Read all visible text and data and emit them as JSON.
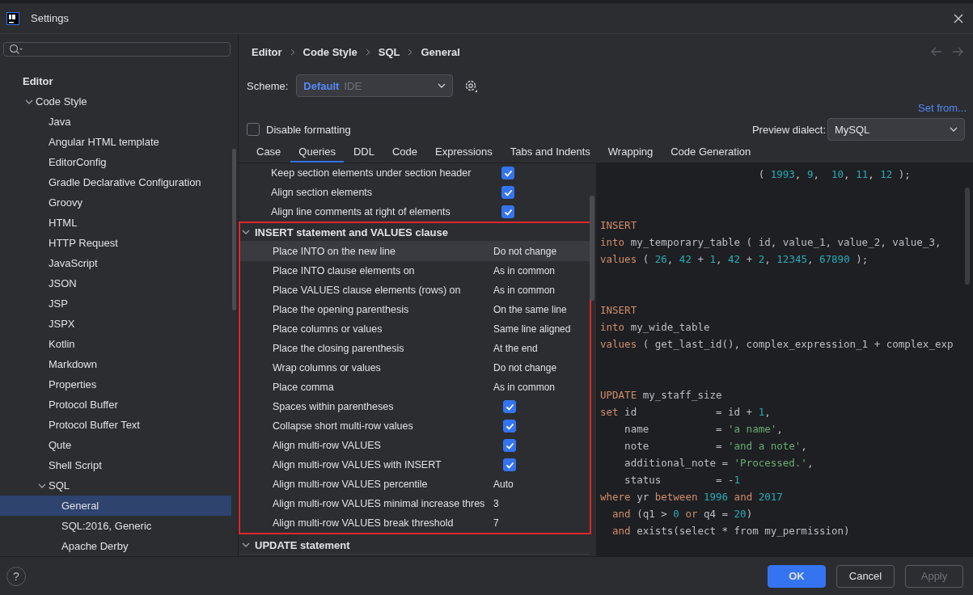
{
  "window": {
    "title": "Settings"
  },
  "sidebar": {
    "tree": [
      {
        "label": "Editor",
        "kind": "group",
        "selected": false,
        "children": [
          {
            "label": "Code Style",
            "kind": "node",
            "selected": false,
            "expanded": true,
            "children": [
              {
                "label": "Java",
                "kind": "node",
                "selected": false
              },
              {
                "label": "Angular HTML template",
                "kind": "node",
                "selected": false
              },
              {
                "label": "EditorConfig",
                "kind": "node",
                "selected": false
              },
              {
                "label": "Gradle Declarative Configuration",
                "kind": "node",
                "selected": false
              },
              {
                "label": "Groovy",
                "kind": "node",
                "selected": false
              },
              {
                "label": "HTML",
                "kind": "node",
                "selected": false
              },
              {
                "label": "HTTP Request",
                "kind": "node",
                "selected": false
              },
              {
                "label": "JavaScript",
                "kind": "node",
                "selected": false
              },
              {
                "label": "JSON",
                "kind": "node",
                "selected": false
              },
              {
                "label": "JSP",
                "kind": "node",
                "selected": false
              },
              {
                "label": "JSPX",
                "kind": "node",
                "selected": false
              },
              {
                "label": "Kotlin",
                "kind": "node",
                "selected": false
              },
              {
                "label": "Markdown",
                "kind": "node",
                "selected": false
              },
              {
                "label": "Properties",
                "kind": "node",
                "selected": false
              },
              {
                "label": "Protocol Buffer",
                "kind": "node",
                "selected": false
              },
              {
                "label": "Protocol Buffer Text",
                "kind": "node",
                "selected": false
              },
              {
                "label": "Qute",
                "kind": "node",
                "selected": false
              },
              {
                "label": "Shell Script",
                "kind": "node",
                "selected": false
              },
              {
                "label": "SQL",
                "kind": "node",
                "selected": false,
                "expanded": true,
                "children": [
                  {
                    "label": "General",
                    "kind": "node",
                    "selected": true
                  },
                  {
                    "label": "SQL:2016, Generic",
                    "kind": "node",
                    "selected": false
                  },
                  {
                    "label": "Apache Derby",
                    "kind": "node",
                    "selected": false
                  }
                ]
              }
            ]
          }
        ]
      }
    ]
  },
  "help": "?",
  "breadcrumb": [
    "Editor",
    "Code Style",
    "SQL",
    "General"
  ],
  "scheme": {
    "label": "Scheme:",
    "name": "Default",
    "tag": "IDE"
  },
  "set_from": "Set from...",
  "disable_formatting": {
    "label": "Disable formatting",
    "checked": false
  },
  "preview_dialect": {
    "label": "Preview dialect:",
    "value": "MySQL"
  },
  "tabs": [
    {
      "label": "Case",
      "selected": false
    },
    {
      "label": "Queries",
      "selected": true
    },
    {
      "label": "DDL",
      "selected": false
    },
    {
      "label": "Code",
      "selected": false
    },
    {
      "label": "Expressions",
      "selected": false
    },
    {
      "label": "Tabs and Indents",
      "selected": false
    },
    {
      "label": "Wrapping",
      "selected": false
    },
    {
      "label": "Code Generation",
      "selected": false
    }
  ],
  "options": {
    "leading_rows": [
      {
        "kind": "checkbox",
        "label": "Keep section elements under section header",
        "checked": true,
        "selected": false
      },
      {
        "kind": "checkbox",
        "label": "Align section elements",
        "checked": true,
        "selected": false
      },
      {
        "kind": "checkbox",
        "label": "Align line comments at right of elements",
        "checked": true,
        "selected": false
      }
    ],
    "sections": [
      {
        "title": "INSERT statement and VALUES clause",
        "expanded": true,
        "highlighted": true,
        "rows": [
          {
            "kind": "value",
            "label": "Place INTO on the new line",
            "value": "Do not change",
            "selected": true
          },
          {
            "kind": "value",
            "label": "Place INTO clause elements on",
            "value": "As in common",
            "selected": false
          },
          {
            "kind": "value",
            "label": "Place VALUES clause elements (rows) on",
            "value": "As in common",
            "selected": false
          },
          {
            "kind": "value",
            "label": "Place the opening parenthesis",
            "value": "On the same line",
            "selected": false
          },
          {
            "kind": "value",
            "label": "Place columns or values",
            "value": "Same line aligned",
            "selected": false
          },
          {
            "kind": "value",
            "label": "Place the closing parenthesis",
            "value": "At the end",
            "selected": false
          },
          {
            "kind": "value",
            "label": "Wrap columns or values",
            "value": "Do not change",
            "selected": false
          },
          {
            "kind": "value",
            "label": "Place comma",
            "value": "As in common",
            "selected": false
          },
          {
            "kind": "checkbox",
            "label": "Spaces within parentheses",
            "checked": true,
            "selected": false
          },
          {
            "kind": "checkbox",
            "label": "Collapse short multi-row values",
            "checked": true,
            "selected": false
          },
          {
            "kind": "checkbox",
            "label": "Align multi-row VALUES",
            "checked": true,
            "selected": false
          },
          {
            "kind": "checkbox",
            "label": "Align multi-row VALUES with INSERT",
            "checked": true,
            "selected": false
          },
          {
            "kind": "value",
            "label": "Align multi-row VALUES percentile",
            "value": "Auto",
            "selected": false
          },
          {
            "kind": "value",
            "label": "Align multi-row VALUES minimal increase thres",
            "value": "3",
            "selected": false
          },
          {
            "kind": "value",
            "label": "Align multi-row VALUES break threshold",
            "value": "7",
            "selected": false
          }
        ]
      },
      {
        "title": "UPDATE statement",
        "expanded": true,
        "highlighted": false
      }
    ]
  },
  "preview": {
    "blocks": [
      [
        [
          {
            "kind": "punct",
            "text": "                          ( "
          },
          {
            "kind": "number",
            "text": "1993"
          },
          {
            "kind": "punct",
            "text": ", "
          },
          {
            "kind": "number",
            "text": "9"
          },
          {
            "kind": "punct",
            "text": ",  "
          },
          {
            "kind": "number",
            "text": "10"
          },
          {
            "kind": "punct",
            "text": ", "
          },
          {
            "kind": "number",
            "text": "11"
          },
          {
            "kind": "punct",
            "text": ", "
          },
          {
            "kind": "number",
            "text": "12"
          },
          {
            "kind": "punct",
            "text": " );"
          }
        ]
      ],
      [
        [
          {
            "kind": "keyword",
            "text": "INSERT"
          }
        ],
        [
          {
            "kind": "keyword",
            "text": "into"
          },
          {
            "kind": "ident",
            "text": " my_temporary_table ( id, value_1, value_2, value_3,"
          }
        ],
        [
          {
            "kind": "keyword",
            "text": "values"
          },
          {
            "kind": "punct",
            "text": " ( "
          },
          {
            "kind": "number",
            "text": "26"
          },
          {
            "kind": "punct",
            "text": ", "
          },
          {
            "kind": "number",
            "text": "42"
          },
          {
            "kind": "punct",
            "text": " + "
          },
          {
            "kind": "number",
            "text": "1"
          },
          {
            "kind": "punct",
            "text": ", "
          },
          {
            "kind": "number",
            "text": "42"
          },
          {
            "kind": "punct",
            "text": " + "
          },
          {
            "kind": "number",
            "text": "2"
          },
          {
            "kind": "punct",
            "text": ", "
          },
          {
            "kind": "number",
            "text": "12345"
          },
          {
            "kind": "punct",
            "text": ", "
          },
          {
            "kind": "number",
            "text": "67890"
          },
          {
            "kind": "punct",
            "text": " );"
          }
        ]
      ],
      [
        [
          {
            "kind": "keyword",
            "text": "INSERT"
          }
        ],
        [
          {
            "kind": "keyword",
            "text": "into"
          },
          {
            "kind": "ident",
            "text": " my_wide_table"
          }
        ],
        [
          {
            "kind": "keyword",
            "text": "values"
          },
          {
            "kind": "ident",
            "text": " ( get_last_id(), complex_expression_1 + complex_exp"
          }
        ]
      ],
      [
        [
          {
            "kind": "keyword",
            "text": "UPDATE"
          },
          {
            "kind": "ident",
            "text": " my_staff_size"
          }
        ],
        [
          {
            "kind": "keyword",
            "text": "set"
          },
          {
            "kind": "ident",
            "text": " id             = id + "
          },
          {
            "kind": "number",
            "text": "1"
          },
          {
            "kind": "punct",
            "text": ","
          }
        ],
        [
          {
            "kind": "ident",
            "text": "    name           = "
          },
          {
            "kind": "string",
            "text": "'a name'"
          },
          {
            "kind": "punct",
            "text": ","
          }
        ],
        [
          {
            "kind": "ident",
            "text": "    note           = "
          },
          {
            "kind": "string",
            "text": "'and a note'"
          },
          {
            "kind": "punct",
            "text": ","
          }
        ],
        [
          {
            "kind": "ident",
            "text": "    additional_note = "
          },
          {
            "kind": "string",
            "text": "'Processed.'"
          },
          {
            "kind": "punct",
            "text": ","
          }
        ],
        [
          {
            "kind": "ident",
            "text": "    status         = -"
          },
          {
            "kind": "number",
            "text": "1"
          }
        ],
        [
          {
            "kind": "keyword",
            "text": "where"
          },
          {
            "kind": "ident",
            "text": " yr "
          },
          {
            "kind": "keyword",
            "text": "between"
          },
          {
            "kind": "number",
            "text": " 1996"
          },
          {
            "kind": "keyword",
            "text": " and"
          },
          {
            "kind": "number",
            "text": " 2017"
          }
        ],
        [
          {
            "kind": "keyword",
            "text": "  and"
          },
          {
            "kind": "ident",
            "text": " (q1 > "
          },
          {
            "kind": "number",
            "text": "0"
          },
          {
            "kind": "keyword",
            "text": " or"
          },
          {
            "kind": "ident",
            "text": " q4 = "
          },
          {
            "kind": "number",
            "text": "20"
          },
          {
            "kind": "punct",
            "text": ")"
          }
        ],
        [
          {
            "kind": "keyword",
            "text": "  and"
          },
          {
            "kind": "ident",
            "text": " exists(select * from my_permission)"
          }
        ]
      ]
    ]
  },
  "buttons": [
    {
      "label": "OK",
      "kind": "primary",
      "disabled": false
    },
    {
      "label": "Cancel",
      "kind": "normal",
      "disabled": false
    },
    {
      "label": "Apply",
      "kind": "normal",
      "disabled": true
    }
  ]
}
